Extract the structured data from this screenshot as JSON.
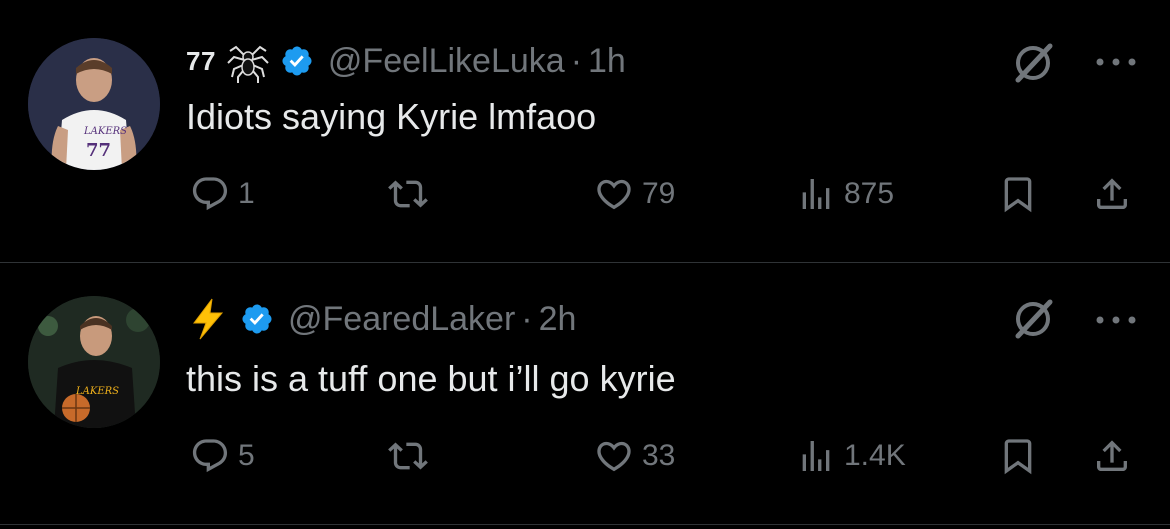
{
  "tweets": [
    {
      "display_name": "77",
      "name_emoji_icon": "spider-icon",
      "verified_icon": "verified-badge-icon",
      "handle": "@FeelLikeLuka",
      "separator": "·",
      "time": "1h",
      "text": "Idiots saying Kyrie lmfaoo",
      "stats": {
        "replies": "1",
        "retweets": "",
        "likes": "79",
        "views": "875"
      }
    },
    {
      "display_name": "",
      "name_emoji_icon": "lightning-icon",
      "verified_icon": "verified-badge-icon",
      "handle": "@FearedLaker",
      "separator": "·",
      "time": "2h",
      "text": "this is a tuff one but i’ll go kyrie",
      "stats": {
        "replies": "5",
        "retweets": "",
        "likes": "33",
        "views": "1.4K"
      }
    }
  ],
  "colors": {
    "background": "#000000",
    "text": "#e7e9ea",
    "muted": "#71767b",
    "divider": "#2f3336",
    "verified": "#1d9bf0"
  }
}
